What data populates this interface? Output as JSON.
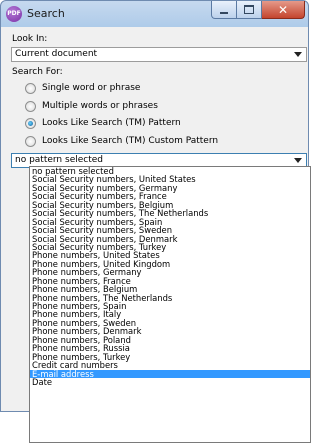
{
  "window": {
    "title": "Search",
    "app_icon_text": "PDF"
  },
  "look_in": {
    "label": "Look In:",
    "value": "Current document"
  },
  "search_for": {
    "label": "Search For:",
    "options": [
      {
        "label": "Single word or phrase",
        "checked": false
      },
      {
        "label": "Multiple words or phrases",
        "checked": false
      },
      {
        "label": "Looks Like Search (TM) Pattern",
        "checked": true
      },
      {
        "label": "Looks Like Search (TM) Custom Pattern",
        "checked": false
      }
    ]
  },
  "pattern": {
    "value": "no pattern selected"
  },
  "dropdown_items": [
    "no pattern selected",
    "Social Security numbers, United States",
    "Social Security numbers, Germany",
    "Social Security numbers, France",
    "Social Security numbers, Belgium",
    "Social Security numbers, The Netherlands",
    "Social Security numbers, Spain",
    "Social Security numbers, Sweden",
    "Social Security numbers, Denmark",
    "Social Security numbers, Turkey",
    "Phone numbers, United States",
    "Phone numbers, United Kingdom",
    "Phone numbers, Germany",
    "Phone numbers, France",
    "Phone numbers, Belgium",
    "Phone numbers, The Netherlands",
    "Phone numbers, Spain",
    "Phone numbers, Italy",
    "Phone numbers, Sweden",
    "Phone numbers, Denmark",
    "Phone numbers, Poland",
    "Phone numbers, Russia",
    "Phone numbers, Turkey",
    "Credit card numbers",
    "E-mail address",
    "Date"
  ],
  "dropdown_selected": "E-mail address"
}
